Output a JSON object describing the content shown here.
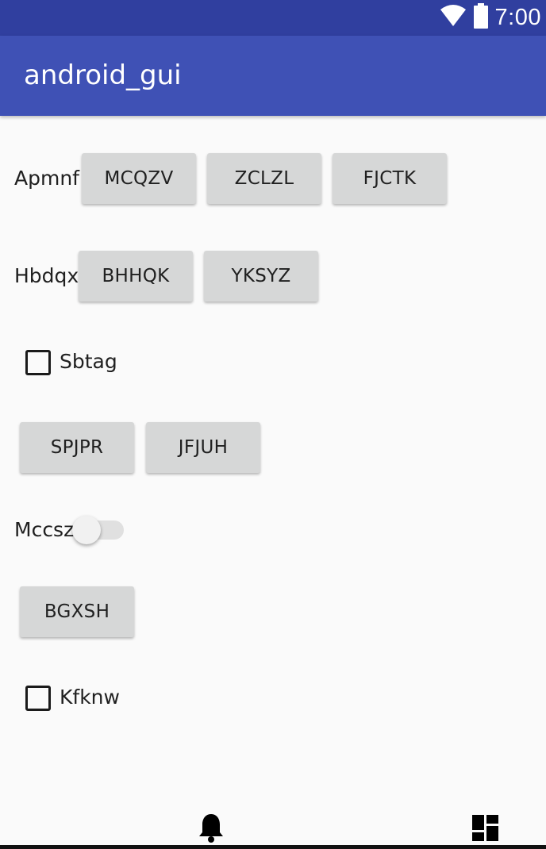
{
  "status_bar": {
    "time": "7:00",
    "icons": [
      "wifi-icon",
      "battery-icon"
    ]
  },
  "app_bar": {
    "title": "android_gui"
  },
  "rows": {
    "row1": {
      "label": "Apmnf",
      "buttons": [
        "MCQZV",
        "ZCLZL",
        "FJCTK"
      ]
    },
    "row2": {
      "label": "Hbdqx",
      "buttons": [
        "BHHQK",
        "YKSYZ"
      ]
    },
    "checkbox1": {
      "label": "Sbtag",
      "checked": false
    },
    "row3": {
      "buttons": [
        "SPJPR",
        "JFJUH"
      ]
    },
    "switch1": {
      "label": "Mccsz",
      "on": false
    },
    "row4": {
      "buttons": [
        "BGXSH"
      ]
    },
    "checkbox2": {
      "label": "Kfknw",
      "checked": false
    }
  },
  "bottom_nav": {
    "icons": [
      "bell-icon",
      "dashboard-icon"
    ]
  },
  "colors": {
    "status_bar": "#303f9f",
    "app_bar": "#3f51b5",
    "background": "#fafafa",
    "button": "#d6d7d7"
  }
}
